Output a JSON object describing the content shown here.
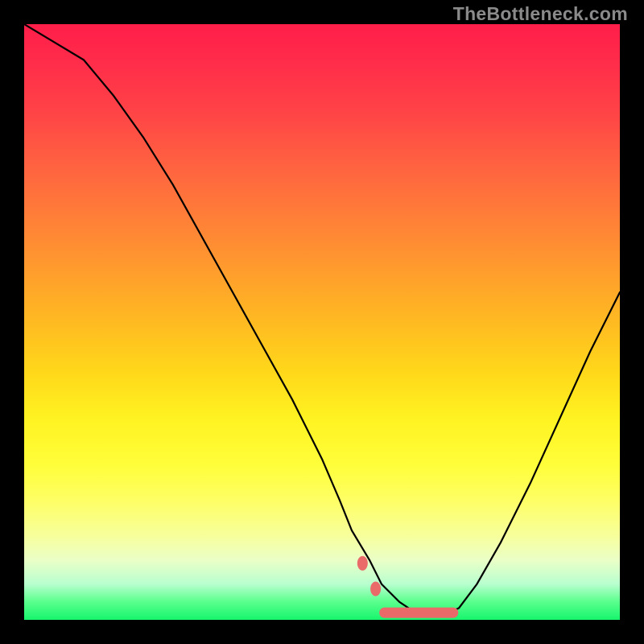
{
  "watermark": "TheBottleneck.com",
  "chart_data": {
    "type": "line",
    "title": "",
    "xlabel": "",
    "ylabel": "",
    "xlim": [
      0,
      100
    ],
    "ylim": [
      0,
      100
    ],
    "series": [
      {
        "name": "bottleneck-curve",
        "x": [
          0,
          5,
          10,
          15,
          20,
          25,
          30,
          35,
          40,
          45,
          50,
          53,
          55,
          58,
          60,
          63,
          66,
          69,
          71,
          73,
          76,
          80,
          85,
          90,
          95,
          100
        ],
        "values": [
          100,
          97,
          94,
          88,
          81,
          73,
          64,
          55,
          46,
          37,
          27,
          20,
          15,
          10,
          6,
          3,
          1,
          1,
          1,
          2,
          6,
          13,
          23,
          34,
          45,
          55
        ]
      }
    ],
    "markers": {
      "name": "optimal-zone",
      "color": "#e96a69",
      "dots": [
        {
          "x": 56.8,
          "y": 9.5
        },
        {
          "x": 59.0,
          "y": 5.2
        }
      ],
      "segment_x": [
        60.5,
        72.0
      ],
      "segment_y": 1.2
    },
    "gradient_stops": [
      {
        "pos": 0,
        "color": "#ff1e4a"
      },
      {
        "pos": 50,
        "color": "#ffd61a"
      },
      {
        "pos": 75,
        "color": "#fffe3a"
      },
      {
        "pos": 100,
        "color": "#17f56d"
      }
    ]
  }
}
